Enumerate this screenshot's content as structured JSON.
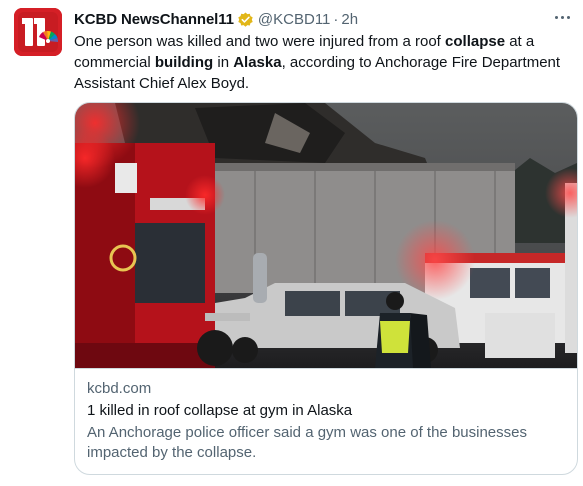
{
  "tweet": {
    "author": {
      "display_name": "KCBD NewsChannel11",
      "handle": "@KCBD11",
      "separator": "·",
      "time": "2h",
      "avatar_icon": "kcbd-11-logo",
      "verified_icon": "gold-verified-badge",
      "verified_color": "#e2b719"
    },
    "text_parts": {
      "p1": "One person was killed and two were injured from a roof ",
      "b1": "collapse",
      "p2": " at a commercial ",
      "b2": "building",
      "p3": " in ",
      "b3": "Alaska",
      "p4": ", according to Anchorage Fire Department Assistant Chief Alex Boyd."
    },
    "more_icon": "more-horizontal-icon",
    "card": {
      "domain": "kcbd.com",
      "title": "1 killed in roof collapse at gym in Alaska",
      "description": "An Anchorage police officer said a gym was one of the businesses impacted by the collapse."
    }
  },
  "colors": {
    "text_primary": "#0f1419",
    "text_secondary": "#536471",
    "border": "#cfd9de",
    "brand_red": "#d51f26"
  }
}
